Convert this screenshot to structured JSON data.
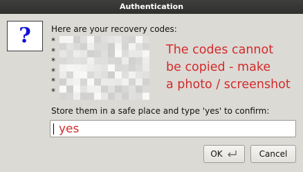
{
  "dialog": {
    "title": "Authentication",
    "message": "Here are your recovery codes:",
    "bullets": [
      "*",
      "*",
      "*",
      "*",
      "*",
      "*"
    ],
    "note_lines": [
      "The codes cannot",
      "be copied - make",
      "a photo / screenshot"
    ],
    "store_label": "Store them in a safe place and type 'yes' to confirm:",
    "input_value": "yes"
  },
  "buttons": {
    "ok_label": "OK",
    "cancel_label": "Cancel"
  },
  "icons": {
    "dialog_icon": "question-icon",
    "ok_icon": "return-key-icon"
  },
  "colors": {
    "annotation": "#d22b2b",
    "question_mark": "#1010d8"
  }
}
